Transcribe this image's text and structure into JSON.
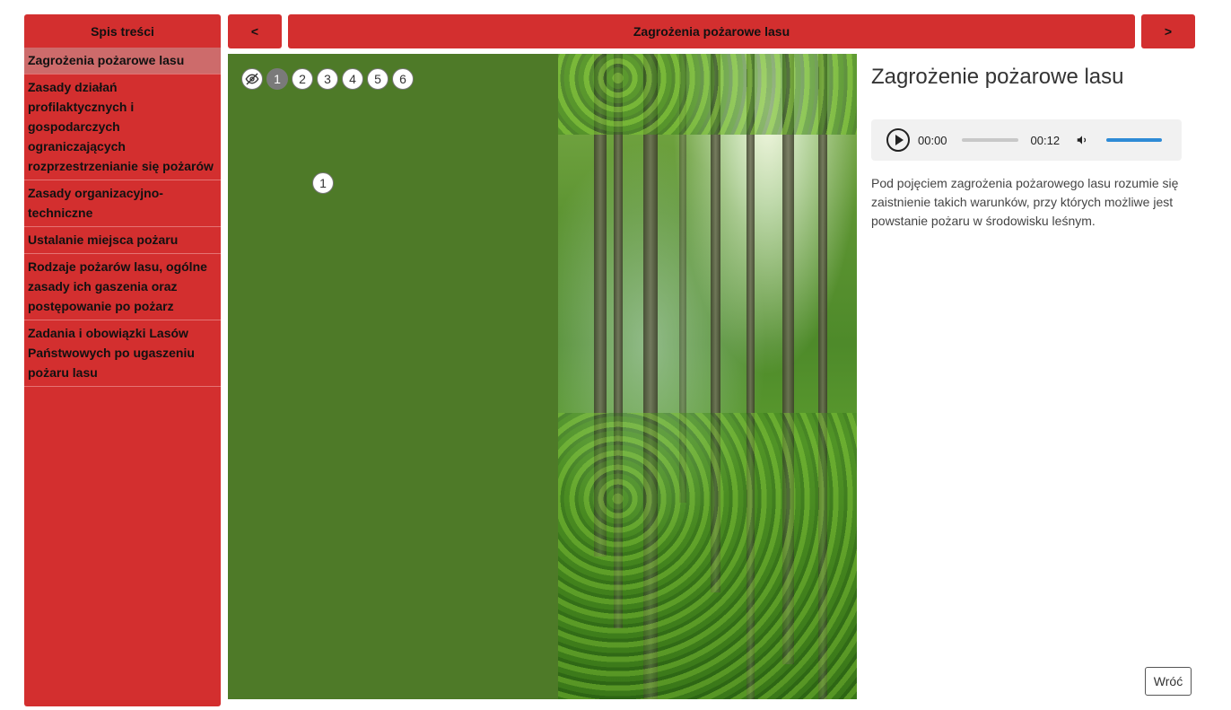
{
  "sidebar": {
    "title": "Spis treści",
    "items": [
      {
        "label": "Zagrożenia pożarowe lasu",
        "active": true
      },
      {
        "label": "Zasady działań profilaktycznych i gospodarczych ograniczających rozprzestrzenianie się pożarów",
        "active": false
      },
      {
        "label": "Zasady organizacyjno-techniczne",
        "active": false
      },
      {
        "label": "Ustalanie miejsca pożaru",
        "active": false
      },
      {
        "label": "Rodzaje pożarów lasu, ogólne zasady ich gaszenia oraz postępowanie po pożarz",
        "active": false
      },
      {
        "label": "Zadania i obowiązki Lasów Państwowych po ugaszeniu pożaru lasu",
        "active": false
      }
    ]
  },
  "nav": {
    "prev_label": "<",
    "title": "Zagrożenia pożarowe lasu",
    "next_label": ">"
  },
  "stage": {
    "steps": [
      "1",
      "2",
      "3",
      "4",
      "5",
      "6"
    ],
    "active_step": "1",
    "visibility_icon": "eye-off-icon",
    "marker_label": "1",
    "panel_color": "#4e7a28"
  },
  "content": {
    "title": "Zagrożenie pożarowe lasu",
    "audio": {
      "current_time": "00:00",
      "duration": "00:12",
      "progress": 0,
      "volume": 1
    },
    "text": "Pod pojęciem zagrożenia pożarowego lasu rozumie się zaistnienie takich warunków, przy których możliwe jest powstanie pożaru w środowisku leśnym.",
    "back_label": "Wróć"
  },
  "colors": {
    "accent": "#d32f2f",
    "active_item": "#cd6b6b",
    "volume": "#2e8bd6"
  }
}
